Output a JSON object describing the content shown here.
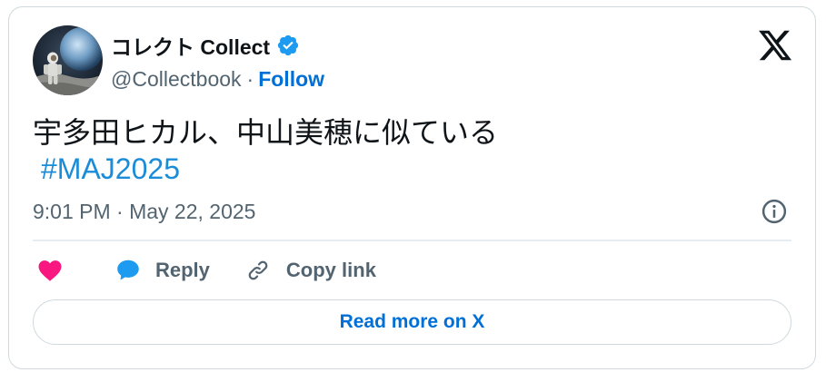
{
  "author": {
    "display_name": "コレクト Collect",
    "handle": "@Collectbook",
    "separator": "·",
    "follow_label": "Follow",
    "verified": true
  },
  "tweet": {
    "text": "宇多田ヒカル、中山美穂に似ている",
    "hashtag": "#MAJ2025",
    "timestamp": "9:01 PM · May 22, 2025"
  },
  "actions": {
    "reply_label": "Reply",
    "copy_link_label": "Copy link"
  },
  "read_more_label": "Read more on X",
  "colors": {
    "link_blue": "#006fd6",
    "hashtag_blue": "#1a8cd8",
    "heart_pink": "#f91880",
    "reply_blue": "#1d9bf0",
    "verified_blue": "#1d9bf0",
    "muted_text": "#536471"
  },
  "icons": [
    "avatar-image",
    "verified-badge-icon",
    "x-logo-icon",
    "info-icon",
    "heart-icon",
    "reply-bubble-icon",
    "link-icon"
  ]
}
